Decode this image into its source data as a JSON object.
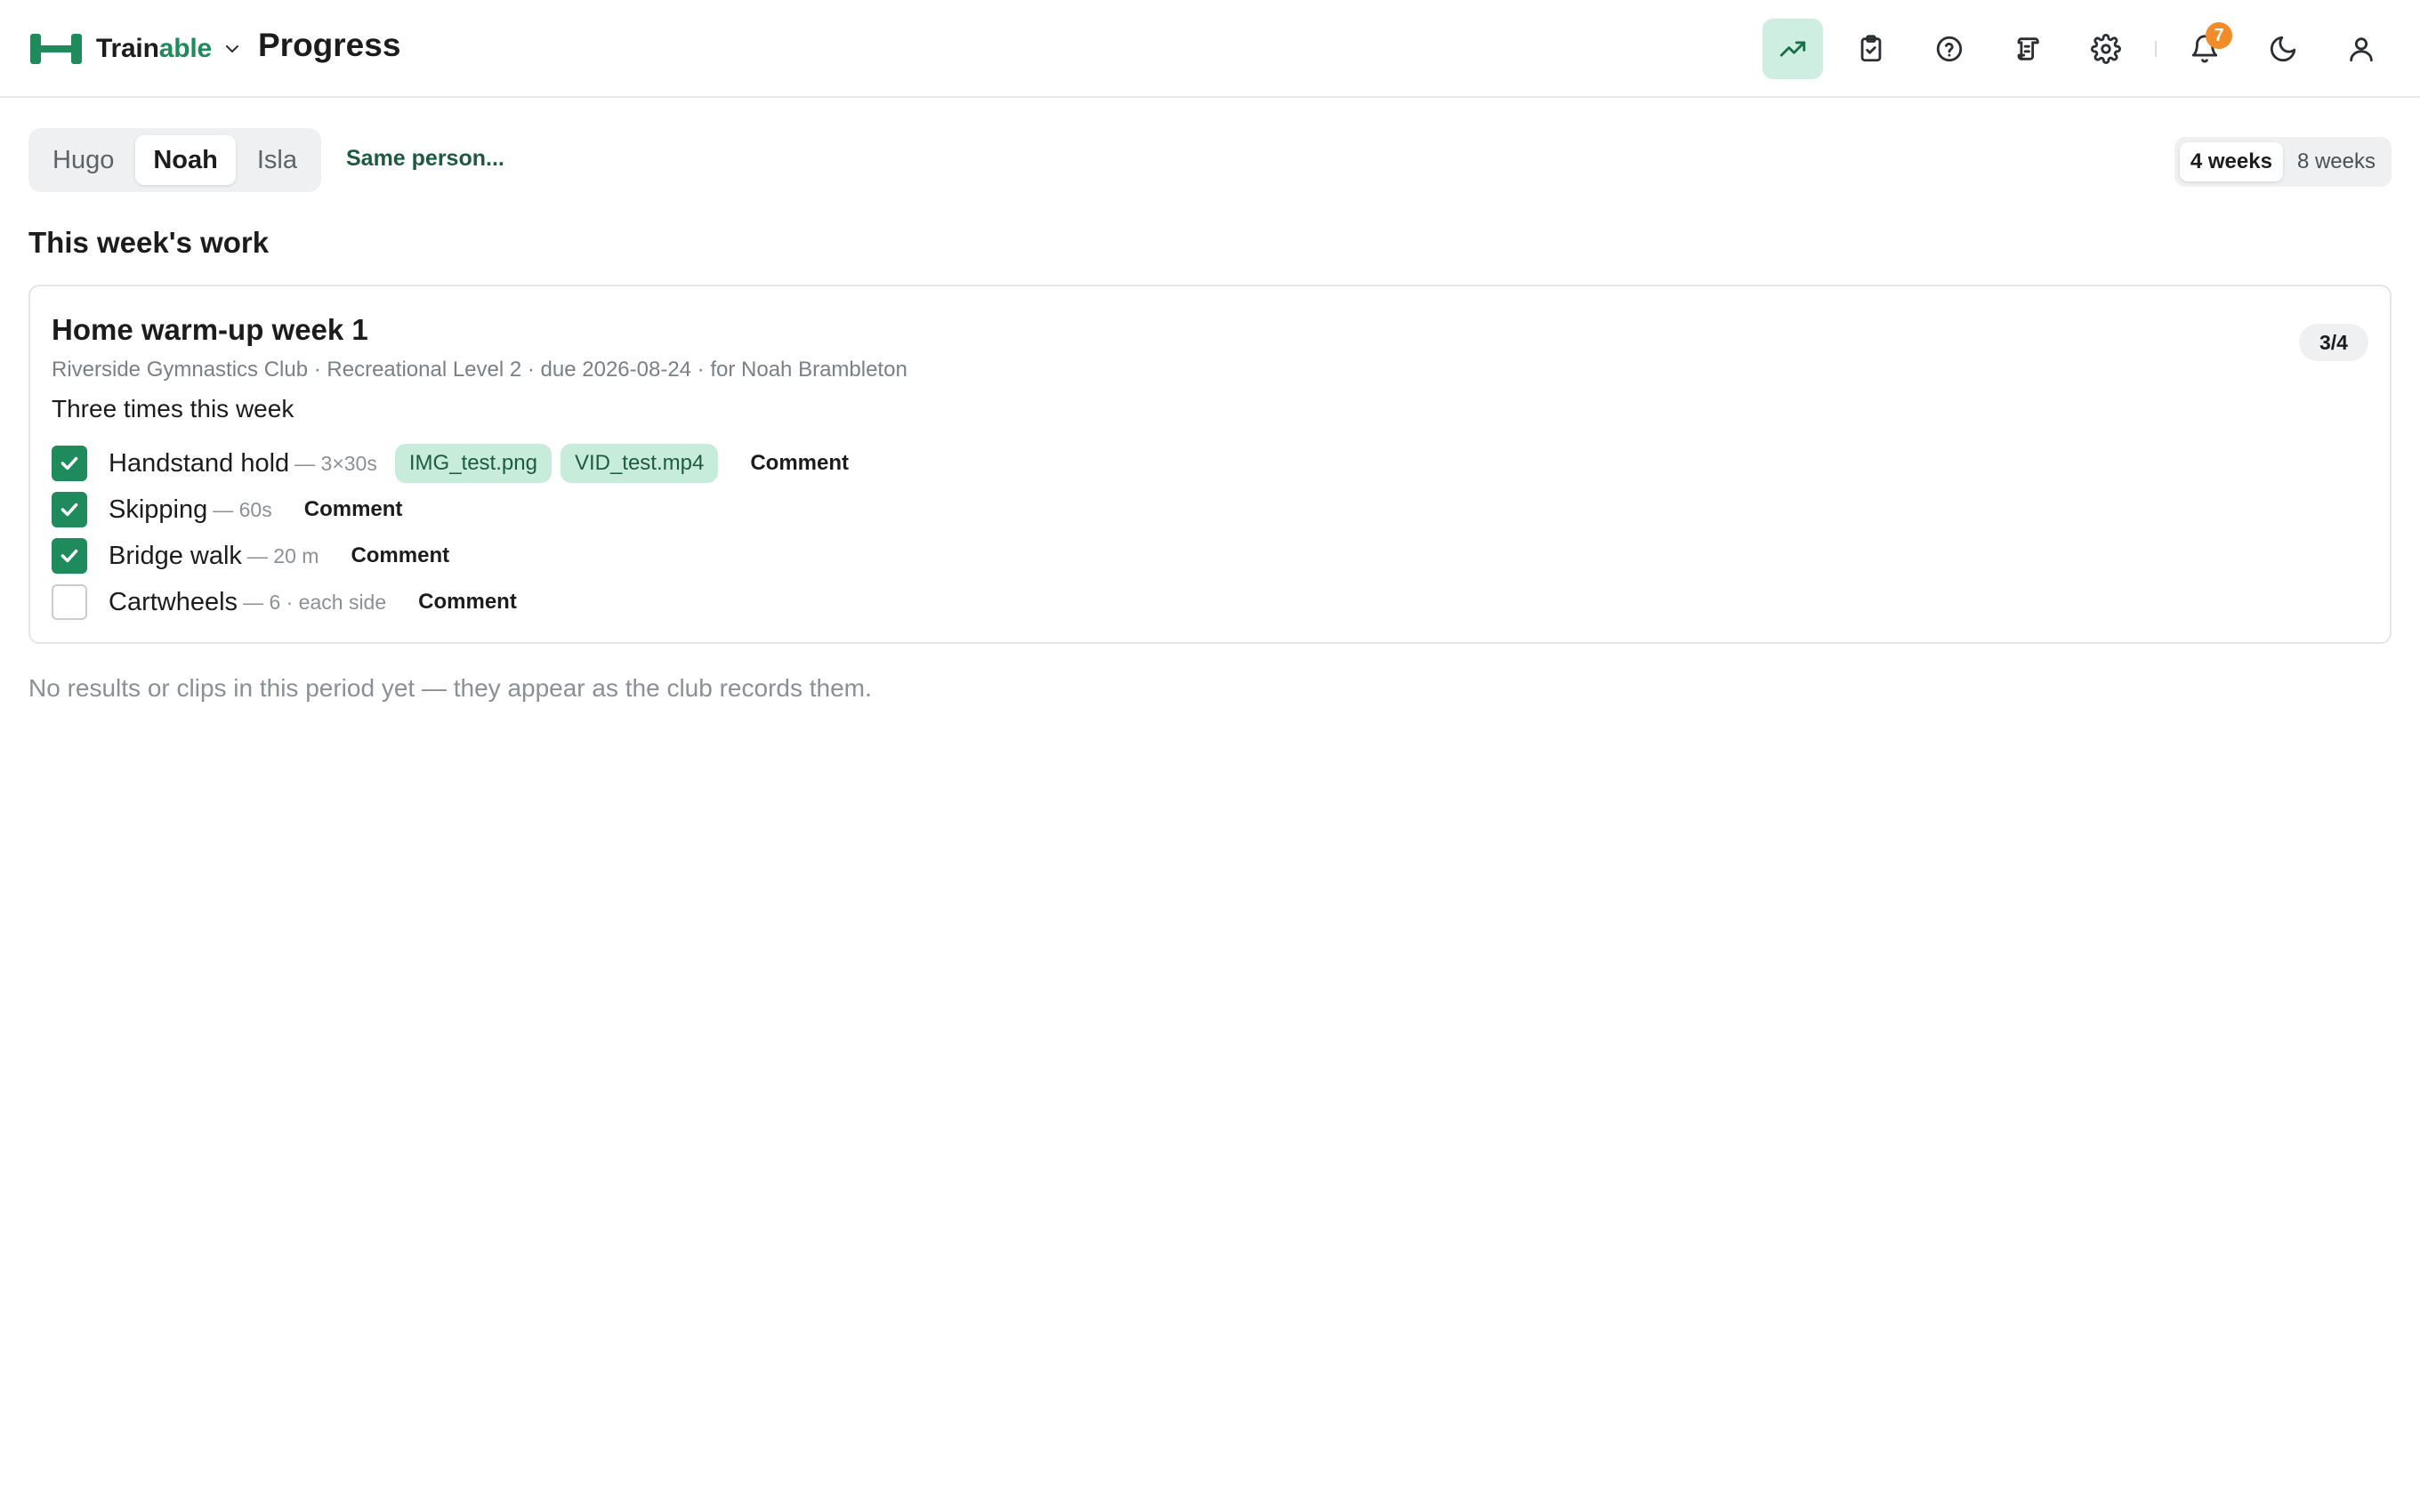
{
  "brand": {
    "name_part1": "Train",
    "name_part2": "able",
    "accent_color": "#1f8a5b"
  },
  "header": {
    "title": "Progress",
    "nav_icons": [
      "trending-up-icon",
      "clipboard-check-icon",
      "help-circle-icon",
      "scroll-icon",
      "gear-icon",
      "bell-icon",
      "moon-icon",
      "user-icon"
    ],
    "notification_count": "7"
  },
  "people": {
    "tabs": [
      {
        "label": "Hugo",
        "active": false
      },
      {
        "label": "Noah",
        "active": true
      },
      {
        "label": "Isla",
        "active": false
      }
    ],
    "same_person_label": "Same person..."
  },
  "range": {
    "options": [
      {
        "label": "4 weeks",
        "active": true
      },
      {
        "label": "8 weeks",
        "active": false
      }
    ]
  },
  "section": {
    "title": "This week's work"
  },
  "card": {
    "title": "Home warm-up week 1",
    "progress": "3/4",
    "meta": "Riverside Gymnastics Club · Recreational Level 2 · due 2026-08-24 · for Noah Brambleton",
    "description": "Three times this week",
    "tasks": [
      {
        "name": "Handstand hold",
        "detail": "— 3×30s",
        "done": true,
        "attachments": [
          "IMG_test.png",
          "VID_test.mp4"
        ],
        "comment_label": "Comment"
      },
      {
        "name": "Skipping",
        "detail": "— 60s",
        "done": true,
        "attachments": [],
        "comment_label": "Comment"
      },
      {
        "name": "Bridge walk",
        "detail": "— 20 m",
        "done": true,
        "attachments": [],
        "comment_label": "Comment"
      },
      {
        "name": "Cartwheels",
        "detail": "— 6 · each side",
        "done": false,
        "attachments": [],
        "comment_label": "Comment"
      }
    ]
  },
  "empty_note": "No results or clips in this period yet — they appear as the club records them."
}
